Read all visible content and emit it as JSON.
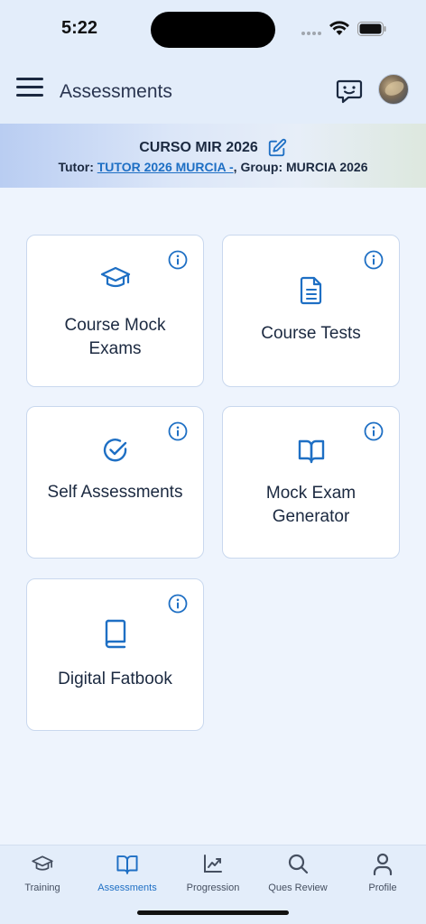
{
  "status_bar": {
    "time": "5:22"
  },
  "header": {
    "title": "Assessments"
  },
  "course": {
    "name": "CURSO MIR 2026",
    "tutor_prefix": "Tutor: ",
    "tutor_link": "TUTOR 2026 MURCIA -",
    "group_text": ", Group: MURCIA 2026"
  },
  "cards": [
    {
      "label": "Course Mock Exams",
      "icon": "graduation-cap-icon"
    },
    {
      "label": "Course Tests",
      "icon": "document-icon"
    },
    {
      "label": "Self Assessments",
      "icon": "check-circle-icon"
    },
    {
      "label": "Mock Exam Generator",
      "icon": "open-book-icon"
    },
    {
      "label": "Digital Fatbook",
      "icon": "book-icon"
    }
  ],
  "nav": [
    {
      "label": "Training",
      "icon": "graduation-cap-icon",
      "active": false
    },
    {
      "label": "Assessments",
      "icon": "open-book-icon",
      "active": true
    },
    {
      "label": "Progression",
      "icon": "chart-icon",
      "active": false
    },
    {
      "label": "Ques Review",
      "icon": "search-icon",
      "active": false
    },
    {
      "label": "Profile",
      "icon": "user-icon",
      "active": false
    }
  ],
  "colors": {
    "accent": "#1e6fc4",
    "text": "#1b2940",
    "background": "#eef4fd"
  }
}
